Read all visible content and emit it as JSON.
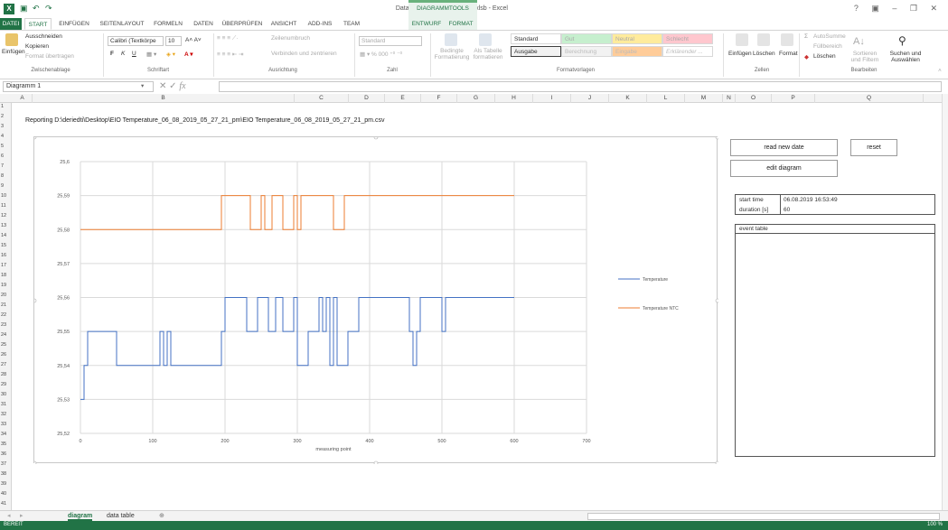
{
  "titlebar": {
    "doc_title": "Data evaluation 2019-06-01.xlsb - Excel",
    "tools_label": "DIAGRAMMTOOLS",
    "quick_access": [
      "save-icon",
      "undo-icon",
      "redo-icon"
    ],
    "window_controls": "? ▣ – ❐ ✕"
  },
  "tabs": [
    "DATEI",
    "START",
    "EINFÜGEN",
    "SEITENLAYOUT",
    "FORMELN",
    "DATEN",
    "ÜBERPRÜFEN",
    "ANSICHT",
    "ADD-INS",
    "TEAM",
    "ENTWURF",
    "FORMAT"
  ],
  "ribbon": {
    "clipboard": {
      "paste": "Einfügen",
      "cut": "Ausschneiden",
      "copy": "Kopieren",
      "format_painter": "Format übertragen",
      "label": "Zwischenablage"
    },
    "font": {
      "name": "Calibri (Textkörpe",
      "size": "10",
      "bold": "F",
      "italic": "K",
      "underline": "U",
      "label": "Schriftart"
    },
    "alignment": {
      "wrap": "Zeilenumbruch",
      "merge": "Verbinden und zentrieren",
      "label": "Ausrichtung"
    },
    "number": {
      "format": "Standard",
      "label": "Zahl"
    },
    "styles": {
      "conditional": "Bedingte Formatierung",
      "as_table": "Als Tabelle formatieren",
      "cells": [
        "Standard",
        "Gut",
        "Neutral",
        "Schlecht",
        "Ausgabe",
        "Berechnung",
        "Eingabe",
        "Erklärender ..."
      ],
      "label": "Formatvorlagen"
    },
    "cells": {
      "insert": "Einfügen",
      "delete": "Löschen",
      "format": "Format",
      "label": "Zellen"
    },
    "editing": {
      "autosum": "AutoSumme",
      "fill": "Füllbereich",
      "clear": "Löschen",
      "sort": "Sortieren und Filtern",
      "find": "Suchen und Auswählen",
      "label": "Bearbeiten"
    }
  },
  "formula_bar": {
    "name_box": "Diagramm 1",
    "fx": "fx"
  },
  "columns": [
    "A",
    "B",
    "C",
    "D",
    "E",
    "F",
    "G",
    "H",
    "I",
    "J",
    "K",
    "L",
    "M",
    "N",
    "O",
    "P",
    "Q"
  ],
  "rows": [
    "1",
    "2",
    "3",
    "4",
    "5",
    "6",
    "7",
    "8",
    "9",
    "10",
    "11",
    "12",
    "13",
    "14",
    "15",
    "16",
    "17",
    "18",
    "19",
    "20",
    "21",
    "22",
    "23",
    "24",
    "25",
    "26",
    "27",
    "28",
    "29",
    "30",
    "31",
    "32",
    "33",
    "34",
    "35",
    "36",
    "37",
    "38",
    "39",
    "40",
    "41"
  ],
  "report_line": "Reporting D:\\deriedti\\Desktop\\EIO Temperature_06_08_2019_05_27_21_pm\\EIO Temperature_06_08_2019_05_27_21_pm.csv",
  "panel": {
    "read_btn": "read new date",
    "reset_btn": "reset",
    "edit_btn": "edit diagram",
    "start_time_label": "start time",
    "start_time_value": "06.08.2019 16:53:49",
    "duration_label": "duration [s]",
    "duration_value": "60",
    "event_table_label": "event table"
  },
  "sheets": {
    "active": "diagram",
    "other": "data table",
    "add": "⊕"
  },
  "status": {
    "left": "BEREIT",
    "zoom": "100 %"
  },
  "colors": {
    "accent": "#217346",
    "series_temperature": "#4472c4",
    "series_ntc": "#ed7d31"
  },
  "chart_data": {
    "type": "line",
    "xlabel": "measuring point",
    "ylabel": "",
    "xlim": [
      0,
      700
    ],
    "ylim": [
      25.52,
      25.6
    ],
    "xticks": [
      0,
      100,
      200,
      300,
      400,
      500,
      600,
      700
    ],
    "yticks": [
      25.52,
      25.53,
      25.54,
      25.55,
      25.56,
      25.57,
      25.58,
      25.59,
      25.6
    ],
    "ytick_labels": [
      "25,52",
      "25,53",
      "25,54",
      "25,55",
      "25,56",
      "25,57",
      "25,58",
      "25,59",
      "25,6"
    ],
    "legend_position": "right",
    "grid": true,
    "series": [
      {
        "name": "Temperature",
        "color": "#4472c4",
        "points": [
          [
            0,
            25.53
          ],
          [
            5,
            25.53
          ],
          [
            5,
            25.54
          ],
          [
            10,
            25.54
          ],
          [
            10,
            25.55
          ],
          [
            50,
            25.55
          ],
          [
            50,
            25.54
          ],
          [
            110,
            25.54
          ],
          [
            110,
            25.55
          ],
          [
            115,
            25.55
          ],
          [
            115,
            25.54
          ],
          [
            120,
            25.54
          ],
          [
            120,
            25.55
          ],
          [
            125,
            25.55
          ],
          [
            125,
            25.54
          ],
          [
            195,
            25.54
          ],
          [
            195,
            25.55
          ],
          [
            200,
            25.55
          ],
          [
            200,
            25.56
          ],
          [
            230,
            25.56
          ],
          [
            230,
            25.55
          ],
          [
            245,
            25.55
          ],
          [
            245,
            25.56
          ],
          [
            260,
            25.56
          ],
          [
            260,
            25.55
          ],
          [
            270,
            25.55
          ],
          [
            270,
            25.56
          ],
          [
            280,
            25.56
          ],
          [
            280,
            25.55
          ],
          [
            295,
            25.55
          ],
          [
            295,
            25.56
          ],
          [
            300,
            25.56
          ],
          [
            300,
            25.54
          ],
          [
            315,
            25.54
          ],
          [
            315,
            25.55
          ],
          [
            330,
            25.55
          ],
          [
            330,
            25.56
          ],
          [
            335,
            25.56
          ],
          [
            335,
            25.55
          ],
          [
            340,
            25.55
          ],
          [
            340,
            25.56
          ],
          [
            345,
            25.56
          ],
          [
            345,
            25.54
          ],
          [
            350,
            25.54
          ],
          [
            350,
            25.56
          ],
          [
            355,
            25.56
          ],
          [
            355,
            25.54
          ],
          [
            370,
            25.54
          ],
          [
            370,
            25.55
          ],
          [
            385,
            25.55
          ],
          [
            385,
            25.56
          ],
          [
            455,
            25.56
          ],
          [
            455,
            25.55
          ],
          [
            460,
            25.55
          ],
          [
            460,
            25.54
          ],
          [
            465,
            25.54
          ],
          [
            465,
            25.55
          ],
          [
            470,
            25.55
          ],
          [
            470,
            25.56
          ],
          [
            500,
            25.56
          ],
          [
            500,
            25.55
          ],
          [
            505,
            25.55
          ],
          [
            505,
            25.56
          ],
          [
            600,
            25.56
          ]
        ]
      },
      {
        "name": "Temperature NTC",
        "color": "#ed7d31",
        "points": [
          [
            0,
            25.58
          ],
          [
            195,
            25.58
          ],
          [
            195,
            25.59
          ],
          [
            235,
            25.59
          ],
          [
            235,
            25.58
          ],
          [
            250,
            25.58
          ],
          [
            250,
            25.59
          ],
          [
            255,
            25.59
          ],
          [
            255,
            25.58
          ],
          [
            265,
            25.58
          ],
          [
            265,
            25.59
          ],
          [
            280,
            25.59
          ],
          [
            280,
            25.58
          ],
          [
            295,
            25.58
          ],
          [
            295,
            25.59
          ],
          [
            300,
            25.59
          ],
          [
            300,
            25.58
          ],
          [
            305,
            25.58
          ],
          [
            305,
            25.59
          ],
          [
            350,
            25.59
          ],
          [
            350,
            25.58
          ],
          [
            365,
            25.58
          ],
          [
            365,
            25.59
          ],
          [
            600,
            25.59
          ]
        ]
      }
    ]
  }
}
